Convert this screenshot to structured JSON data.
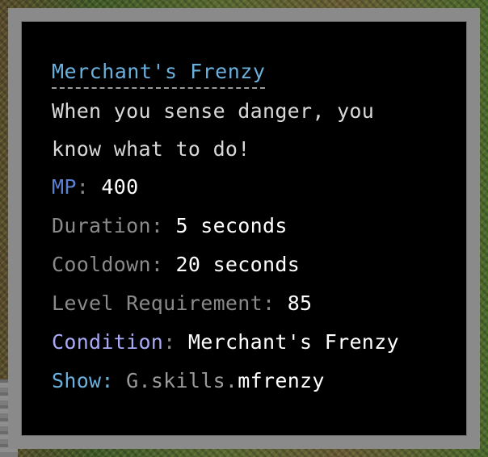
{
  "tooltip": {
    "title": "Merchant's Frenzy",
    "description_line1": "When you sense danger, you",
    "description_line2": "know what to do!",
    "stats": {
      "mp_label": "MP",
      "mp_value": "400",
      "duration_label": "Duration",
      "duration_value": "5 seconds",
      "cooldown_label": "Cooldown",
      "cooldown_value": "20 seconds",
      "level_label": "Level Requirement",
      "level_value": "85",
      "condition_label": "Condition",
      "condition_value": "Merchant's Frenzy",
      "show_label": "Show",
      "show_prefix": "G.skills.",
      "show_key": "mfrenzy"
    },
    "separator": ":",
    "colors": {
      "title": "#6ab0dc",
      "description": "#d8d8d8",
      "mp_label": "#5d7fd0",
      "gray_label": "#8a8a8a",
      "condition_label": "#a9a9f5",
      "show_label": "#6ab0dc",
      "value": "#ffffff",
      "frame": "#8a8a8a",
      "background": "#000000"
    }
  }
}
